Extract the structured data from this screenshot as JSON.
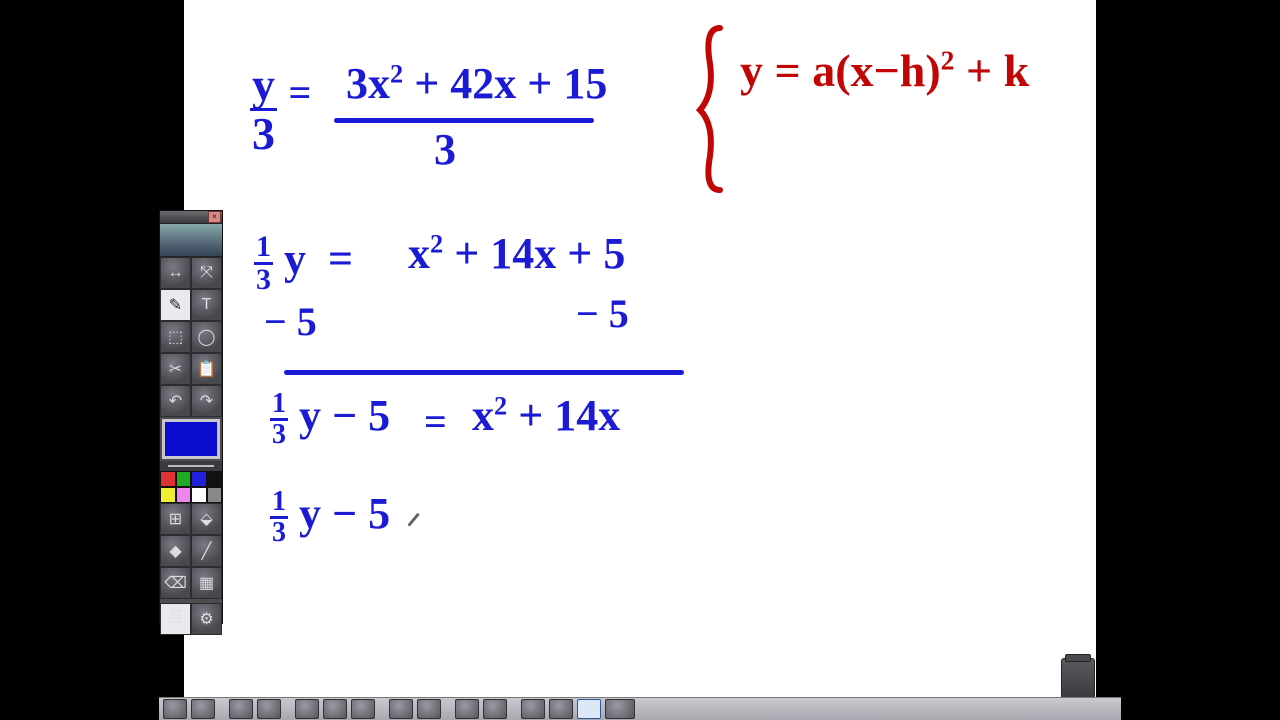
{
  "whiteboard": {
    "line1_lhs_num": "y",
    "line1_lhs_den": "3",
    "line1_rhs_raw": "3x² + 42x + 15",
    "line1_rhs_den": "3",
    "line2_lhs": "⅓ y",
    "line2_rhs": "x² + 14x + 5",
    "line2_sub_l": "− 5",
    "line2_sub_r": "− 5",
    "line3_lhs": "⅓ y − 5",
    "line3_eq": "=",
    "line3_rhs": "x² + 14x",
    "line4": "⅓ y − 5",
    "vertex_form": "y = a(x−h)² + k"
  },
  "palette": {
    "tools": [
      "↔",
      "⤧",
      "✎",
      "T",
      "⬚",
      "◯",
      "✂",
      "📋",
      "↶",
      "↷",
      "⊞",
      "⌫"
    ],
    "selected_index": 2,
    "swatches_row1": [
      "#d33",
      "#2a2",
      "#22d",
      "#111"
    ],
    "swatches_row2": [
      "#ee3",
      "#e8e",
      "#fff",
      "#888"
    ]
  },
  "taskbar": {
    "buttons": 18,
    "selected": 15
  }
}
